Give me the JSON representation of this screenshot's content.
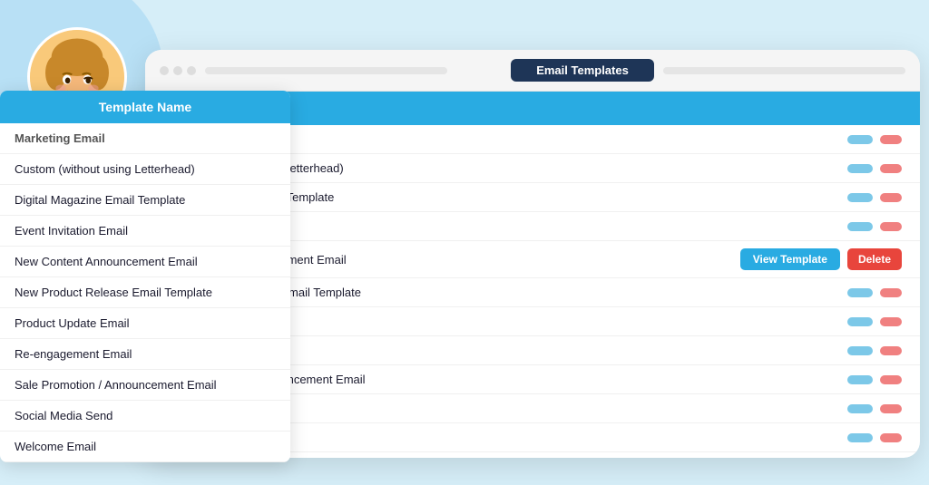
{
  "background": {
    "color": "#d6eef8"
  },
  "browser": {
    "tab_label": "Email Templates",
    "table": {
      "header": {
        "col_name": "Template Name",
        "col_view": "View Template",
        "col_delete": "Delete"
      },
      "rows": [
        {
          "name": "Marketing Email",
          "highlight": false
        },
        {
          "name": "Custom (without using Letterhead)",
          "highlight": false
        },
        {
          "name": "Digital Magazine Email Template",
          "highlight": false
        },
        {
          "name": "Event Invitation Email",
          "highlight": false
        },
        {
          "name": "New Content Announcement Email",
          "highlight": true
        },
        {
          "name": "New Product Release Email Template",
          "highlight": false
        },
        {
          "name": "Product Update Email",
          "highlight": false
        },
        {
          "name": "Re-engagement Email",
          "highlight": false
        },
        {
          "name": "Sale Promotion / Announcement Email",
          "highlight": false
        },
        {
          "name": "Social Media Send",
          "highlight": false
        },
        {
          "name": "Welcome Email",
          "highlight": false
        }
      ],
      "view_label": "View Template",
      "delete_label": "Delete"
    }
  },
  "dropdown": {
    "header": "Template Name",
    "items": [
      "Marketing Email",
      "Custom (without using Letterhead)",
      "Digital Magazine Email Template",
      "Event Invitation Email",
      "New Content Announcement Email",
      "New Product Release Email Template",
      "Product Update Email",
      "Re-engagement Email",
      "Sale Promotion / Announcement Email",
      "Social Media Send",
      "Welcome Email"
    ]
  }
}
